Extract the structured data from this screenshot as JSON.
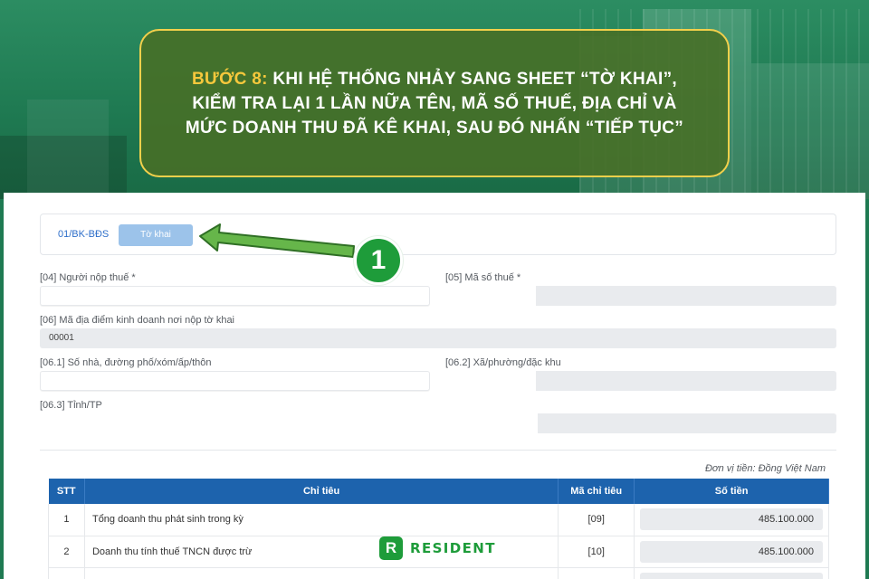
{
  "banner": {
    "step": "BƯỚC 8:",
    "line1": "KHI HỆ THỐNG NHẢY SANG SHEET “TỜ KHAI”,",
    "line2": "KIỂM TRA LẠI 1 LẦN NỮA TÊN, MÃ SỐ THUẾ, ĐỊA CHỈ VÀ",
    "line3": "MỨC DOANH THU ĐÃ KÊ KHAI, SAU ĐÓ NHẤN “TIẾP TỤC”"
  },
  "tabs": [
    {
      "label": "01/BK-BĐS",
      "active": false
    },
    {
      "label": "Tờ khai",
      "active": true
    }
  ],
  "callout": {
    "number": "1",
    "color": "#1e9c3a"
  },
  "form": {
    "taxpayer_label": "[04] Người nộp thuế *",
    "tax_code_label": "[05] Mã số thuế *",
    "business_location_label": "[06] Mã địa điểm kinh doanh nơi nộp tờ khai",
    "business_location_value": "00001",
    "street_label": "[06.1] Số nhà, đường phố/xóm/ấp/thôn",
    "ward_label": "[06.2] Xã/phường/đặc khu",
    "province_label": "[06.3] Tỉnh/TP"
  },
  "currency_note": "Đơn vị tiền: Đồng Việt Nam",
  "table": {
    "headers": [
      "STT",
      "Chỉ tiêu",
      "Mã chỉ tiêu",
      "Số tiền"
    ],
    "rows": [
      {
        "stt": "1",
        "name": "Tổng doanh thu phát sinh trong kỳ",
        "code": "[09]",
        "amount": "485.100.000"
      },
      {
        "stt": "2",
        "name": "Doanh thu tính thuế TNCN được trừ",
        "code": "[10]",
        "amount": "485.100.000"
      }
    ]
  },
  "brand": {
    "mark": "R",
    "name": "RESIDENT",
    "color": "#1e9c3a"
  },
  "colors": {
    "banner_border": "#f2d04b",
    "step_highlight": "#f6c83c",
    "table_header": "#1d63ad",
    "background": "#1f7a52"
  }
}
